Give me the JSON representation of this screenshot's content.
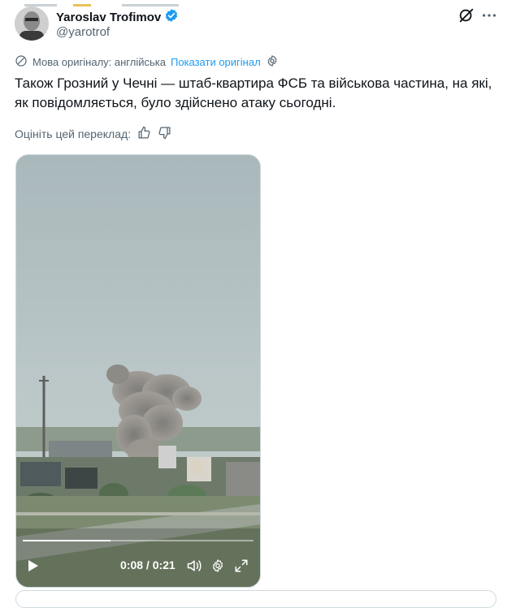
{
  "author": {
    "name": "Yaroslav Trofimov",
    "handle": "@yarotrof",
    "verified": true
  },
  "translation": {
    "source_label": "Мова оригіналу: англійська",
    "show_original": "Показати оригінал"
  },
  "tweet": {
    "text": "Також Грозний у Чечні — штаб-квартира ФСБ та військова частина, на які, як повідомляється, було здійснено атаку сьогодні."
  },
  "rating": {
    "prompt": "Оцініть цей переклад:"
  },
  "video": {
    "time_display": "0:08 / 0:21",
    "progress": 0.381
  },
  "colors": {
    "accent": "#1d9bf0",
    "text_primary": "#0f1419",
    "text_secondary": "#536471",
    "border": "#cfd9de"
  },
  "icons": {
    "verified": "verified-badge-icon",
    "grok": "grok-icon",
    "more": "more-options-icon",
    "translate": "translate-icon",
    "settings": "gear-icon",
    "thumbs_up": "thumbs-up-icon",
    "thumbs_down": "thumbs-down-icon",
    "play": "play-icon",
    "volume": "volume-icon",
    "fullscreen": "fullscreen-icon"
  }
}
